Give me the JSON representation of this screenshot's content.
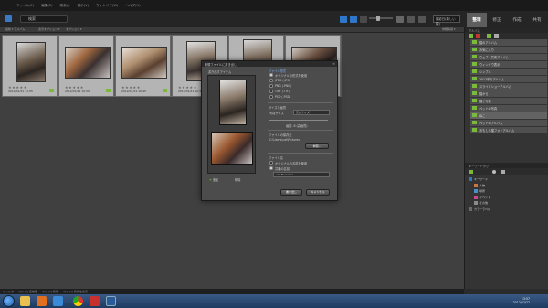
{
  "menu": [
    "ファイル(F)",
    "編集(E)",
    "検索(I)",
    "表示(V)",
    "ウィンドウ(W)",
    "ヘルプ(H)"
  ],
  "search": {
    "value": "検索"
  },
  "sort_label": "撮影日(新しい順)",
  "modes": [
    "整理",
    "修正",
    "作成",
    "共有"
  ],
  "subbar": {
    "left": "最新 ▾  アルバム",
    "middle": "表示オプション ▾",
    "right": "オプション ▾",
    "far_right": "詳細情報 ▾"
  },
  "thumbnails": [
    {
      "stars": "★★★★★",
      "date": "2012/01/21 11:05"
    },
    {
      "stars": "★★★★★",
      "date": "2012/01/21 10:59"
    },
    {
      "stars": "★★★★★",
      "date": "2012/01/21 10:45"
    },
    {
      "stars": "★★★★★",
      "date": "2012/01/21 10:30"
    },
    {
      "stars": "★★★★★",
      "date": "2012/01/21 10:22"
    },
    {
      "stars": "★★★★★",
      "date": "2012/01/21 10:10"
    }
  ],
  "albums": {
    "header": "アルバム",
    "items": [
      "猫のアルバム",
      "お気に入り",
      "ウェブ・共有アルバム",
      "ウィンドウ表示",
      "シンプル",
      "2012年のアルバム",
      "スライドショーアルバム",
      "猫から",
      "猫と写真",
      "ペットの写真",
      "ねこ",
      "ペットのアルバム",
      "おもしろ猫フォトアルバム"
    ]
  },
  "tags": {
    "header": "キーワードタグ",
    "items": [
      "キーワード",
      "人物",
      "場所",
      "イベント",
      "その他",
      "カラーラベル"
    ]
  },
  "statusbar": [
    "フィルタ",
    "ファイル名前順",
    "ファイル情報",
    "ファイル情報を表示"
  ],
  "tray": {
    "time": "13:57",
    "date": "2012/02/22"
  },
  "dialog": {
    "title": "新規ファイルに書き出し",
    "preview_label": "書き出すアイテム",
    "add_label": "追加",
    "remove_label": "削除",
    "section_filetype": "ファイル形式",
    "options": [
      "オリジナルの形式を使用",
      "JPEG (.JPG)",
      "PNG (.PNG)",
      "TIFF (.TIF)",
      "PSD (.PSD)"
    ],
    "section_size": "サイズと画質",
    "size_label": "写真サイズ",
    "size_value": "元のサイズ",
    "quality_label": "画質: 8 (高画質)",
    "section_location": "ファイルの保存先",
    "location_value": "C:\\Users\\cat\\Pictures",
    "browse_label": "参照...",
    "section_filename": "ファイル名",
    "filename_options": [
      "オリジナルの名前を使用",
      "共通の名前"
    ],
    "filename_value": "cat-Favorites",
    "export_button": "書き出し",
    "cancel_button": "キャンセル"
  }
}
